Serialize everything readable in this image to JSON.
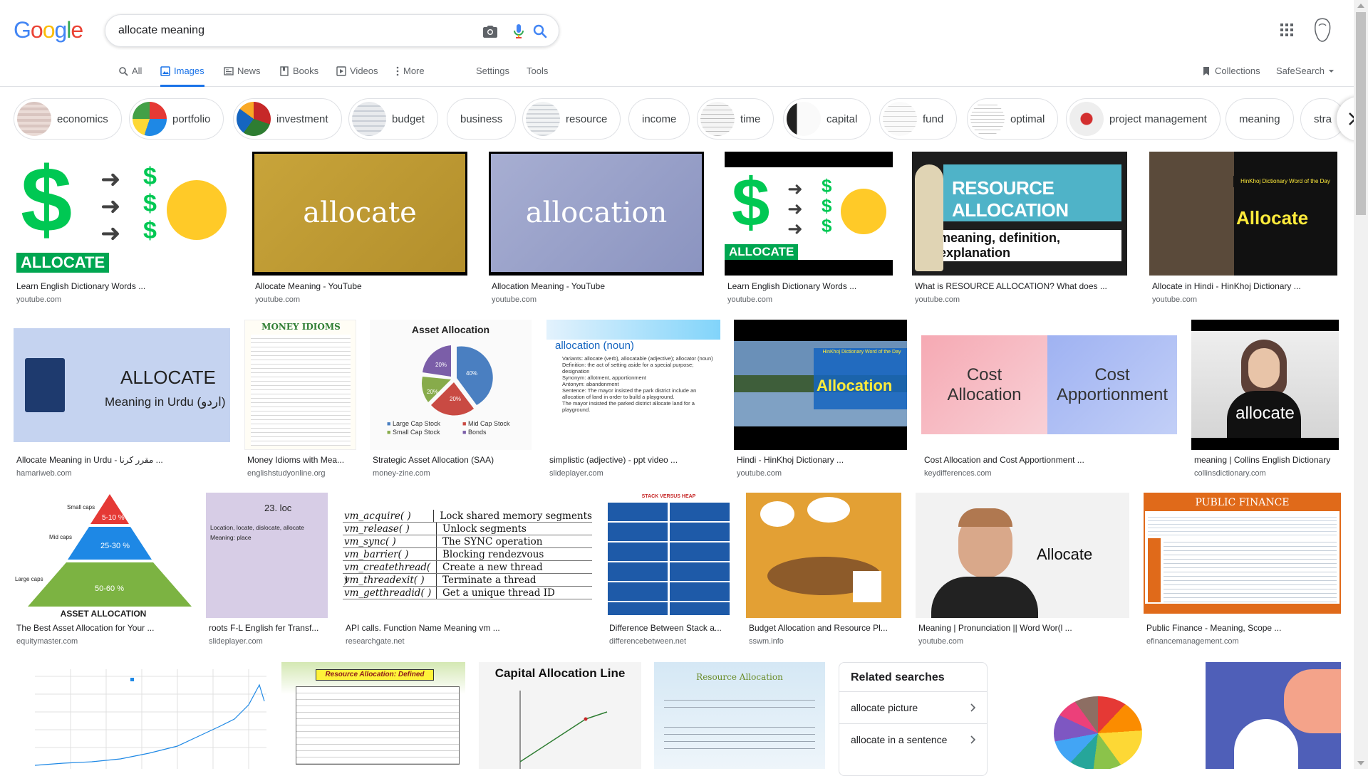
{
  "logo": "Google",
  "search": {
    "query": "allocate meaning"
  },
  "tabs": [
    {
      "label": "All",
      "icon": "search-icon"
    },
    {
      "label": "Images",
      "icon": "image-icon"
    },
    {
      "label": "News",
      "icon": "news-icon"
    },
    {
      "label": "Books",
      "icon": "book-icon"
    },
    {
      "label": "Videos",
      "icon": "video-icon"
    },
    {
      "label": "More",
      "icon": "more-vert-icon"
    },
    {
      "label": "Settings"
    },
    {
      "label": "Tools"
    }
  ],
  "collections_label": "Collections",
  "safesearch_label": "SafeSearch",
  "chips": [
    "economics",
    "portfolio",
    "investment",
    "budget",
    "business",
    "resource",
    "income",
    "time",
    "capital",
    "fund",
    "optimal",
    "project management",
    "meaning",
    "stra"
  ],
  "results": [
    {
      "title": "Learn English Dictionary Words ...",
      "domain": "youtube.com",
      "img_text": "ALLOCATE"
    },
    {
      "title": "Allocate Meaning - YouTube",
      "domain": "youtube.com",
      "img_text": "allocate"
    },
    {
      "title": "Allocation Meaning - YouTube",
      "domain": "youtube.com",
      "img_text": "allocation"
    },
    {
      "title": "Learn English Dictionary Words ...",
      "domain": "youtube.com",
      "img_text": "ALLOCATE"
    },
    {
      "title": "What is RESOURCE ALLOCATION? What does ...",
      "domain": "youtube.com",
      "img_text": "RESOURCE ALLOCATION",
      "img_text2": "meaning, definition, explanation"
    },
    {
      "title": "Allocate in Hindi - HinKhoj Dictionary ...",
      "domain": "youtube.com",
      "img_text": "Allocate",
      "img_text2": "HinKhoj Dictionary Word of the Day"
    },
    {
      "title": "Allocate Meaning in Urdu - مقرر کرنا ...",
      "domain": "hamariweb.com",
      "img_text": "ALLOCATE",
      "img_text2": "Meaning in Urdu (اردو)"
    },
    {
      "title": "Money Idioms with Mea...",
      "domain": "englishstudyonline.org",
      "img_text": "MONEY IDIOMS"
    },
    {
      "title": "Strategic Asset Allocation (SAA)",
      "domain": "money-zine.com",
      "img_text": "Asset Allocation"
    },
    {
      "title": "simplistic (adjective) - ppt video ...",
      "domain": "slideplayer.com",
      "img_text": "allocation (noun)"
    },
    {
      "title": "Hindi - HinKhoj Dictionary ...",
      "domain": "youtube.com",
      "img_text": "Allocation",
      "img_text2": "HinKhoj Dictionary Word of the Day"
    },
    {
      "title": "Cost Allocation and Cost Apportionment ...",
      "domain": "keydifferences.com",
      "img_text": "Cost Allocation",
      "img_text2": "Cost Apportionment"
    },
    {
      "title": "meaning | Collins English Dictionary",
      "domain": "collinsdictionary.com",
      "img_text": "allocate"
    },
    {
      "title": "The Best Asset Allocation for Your ...",
      "domain": "equitymaster.com",
      "img_text": "ASSET ALLOCATION"
    },
    {
      "title": "roots F-L English fer Transf...",
      "domain": "slideplayer.com",
      "img_text": "23.  loc"
    },
    {
      "title": "API calls. Function Name Meaning vm ...",
      "domain": "researchgate.net"
    },
    {
      "title": "Difference Between Stack a...",
      "domain": "differencebetween.net",
      "img_text": "STACK VERSUS HEAP"
    },
    {
      "title": "Budget Allocation and Resource Pl...",
      "domain": "sswm.info"
    },
    {
      "title": "Meaning | Pronunciation || Word Wor(l ...",
      "domain": "youtube.com",
      "img_text": "Allocate"
    },
    {
      "title": "Public Finance - Meaning, Scope ...",
      "domain": "efinancemanagement.com",
      "img_text": "PUBLIC FINANCE"
    }
  ],
  "row4": [
    {
      "img_text": ""
    },
    {
      "img_text": "Resource Allocation: Defined"
    },
    {
      "img_text": "Capital Allocation Line"
    },
    {
      "img_text": "Resource Allocation"
    }
  ],
  "related": {
    "heading": "Related searches",
    "items": [
      "allocate picture",
      "allocate in a sentence"
    ]
  },
  "pyramid": {
    "top": "5-10 %",
    "mid": "25-30 %",
    "bottom": "50-60 %",
    "small": "Small caps",
    "midcaps": "Mid caps",
    "large": "Large caps"
  },
  "pie_labels": {
    "a": "40%",
    "b": "20%",
    "c": "20%",
    "d": "20%",
    "legend": [
      "Large Cap Stock",
      "Small Cap Stock",
      "Mid Cap Stock",
      "Bonds"
    ]
  },
  "vm_table": [
    [
      "vm_acquire( )",
      "Lock shared memory segments"
    ],
    [
      "vm_release( )",
      "Unlock segments"
    ],
    [
      "vm_sync( )",
      "The SYNC operation"
    ],
    [
      "vm_barrier( )",
      "Blocking rendezvous"
    ],
    [
      "vm_createthread( )",
      "Create a new thread"
    ],
    [
      "vm_threadexit( )",
      "Terminate a thread"
    ],
    [
      "vm_getthreadid( )",
      "Get a unique thread ID"
    ]
  ],
  "loc_bullets": [
    "Location, locate, dislocate, allocate",
    "Meaning: place"
  ],
  "allocation_noun_bullets": [
    "Variants: allocate (verb), allocatable (adjective); allocator (noun)",
    "Definition: the act of setting aside for a special purpose; designation",
    "Synonym: allotment, apportionment",
    "Antonym: abandonment",
    "Sentence: The mayor insisted the park district include an allocation of land in order to build a playground.",
    "The mayor insisted the parked district allocate land for a playground."
  ],
  "colors": {
    "blue": "#4285F4",
    "red": "#EA4335",
    "yellow": "#FBBC05",
    "green": "#34A853",
    "accent": "#1a73e8"
  }
}
